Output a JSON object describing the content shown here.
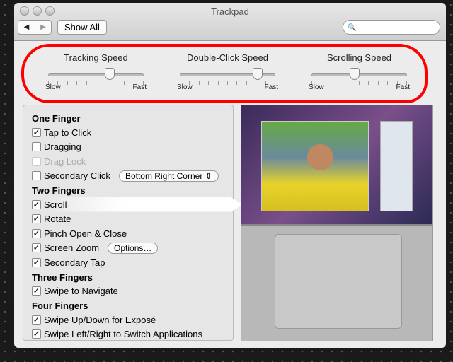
{
  "window": {
    "title": "Trackpad"
  },
  "toolbar": {
    "back": "◀",
    "forward": "▶",
    "show_all": "Show All",
    "search_icon": "🔍",
    "search_value": ""
  },
  "sliders": [
    {
      "label": "Tracking Speed",
      "min_label": "Slow",
      "max_label": "Fast",
      "value": 0.65
    },
    {
      "label": "Double-Click Speed",
      "min_label": "Slow",
      "max_label": "Fast",
      "value": 0.82
    },
    {
      "label": "Scrolling Speed",
      "min_label": "Slow",
      "max_label": "Fast",
      "value": 0.45
    }
  ],
  "annotation_color": "#ff0000",
  "sections": [
    {
      "title": "One Finger",
      "items": [
        {
          "label": "Tap to Click",
          "checked": true
        },
        {
          "label": "Dragging",
          "checked": false
        },
        {
          "label": "Drag Lock",
          "checked": false,
          "disabled": true
        },
        {
          "label": "Secondary Click",
          "checked": false,
          "popup": "Bottom Right Corner ⇕"
        }
      ]
    },
    {
      "title": "Two Fingers",
      "items": [
        {
          "label": "Scroll",
          "checked": true,
          "selected": true
        },
        {
          "label": "Rotate",
          "checked": true
        },
        {
          "label": "Pinch Open & Close",
          "checked": true
        },
        {
          "label": "Screen Zoom",
          "checked": true,
          "button": "Options…"
        },
        {
          "label": "Secondary Tap",
          "checked": true
        }
      ]
    },
    {
      "title": "Three Fingers",
      "items": [
        {
          "label": "Swipe to Navigate",
          "checked": true
        }
      ]
    },
    {
      "title": "Four Fingers",
      "items": [
        {
          "label": "Swipe Up/Down for Exposé",
          "checked": true
        },
        {
          "label": "Swipe Left/Right to Switch Applications",
          "checked": true
        }
      ]
    }
  ]
}
